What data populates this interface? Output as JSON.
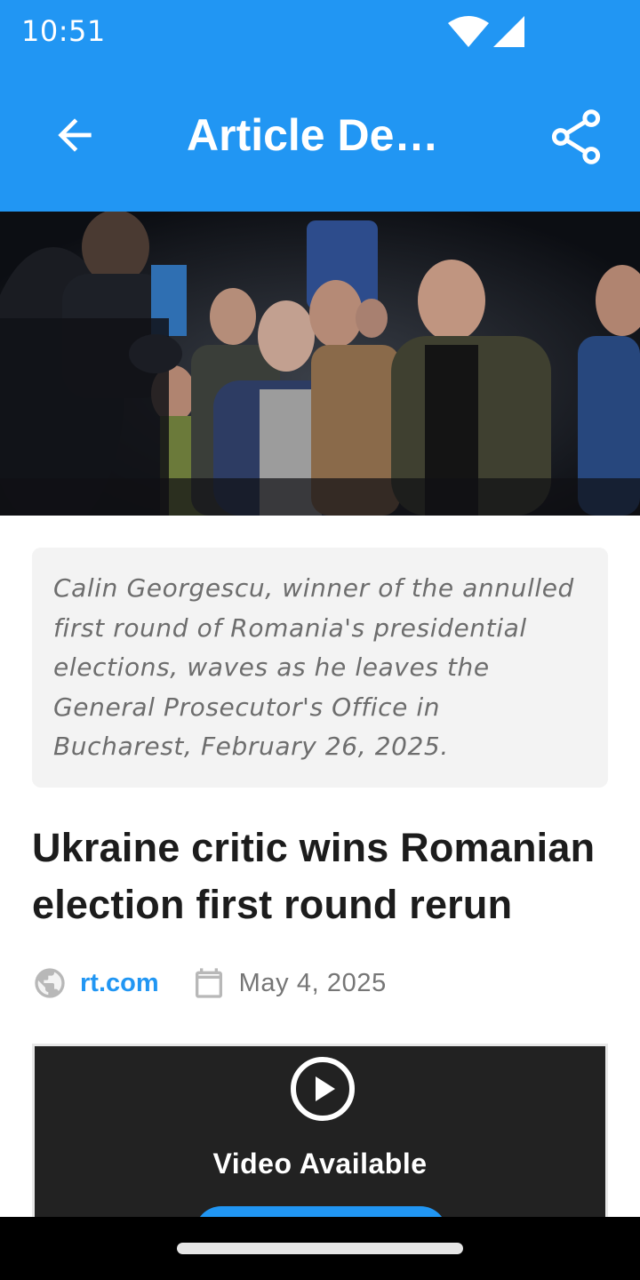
{
  "status_bar": {
    "time": "10:51",
    "icons": [
      "wifi-icon",
      "cellular-signal-icon"
    ]
  },
  "app_bar": {
    "title": "Article Det…",
    "back_icon": "arrow-left-icon",
    "share_icon": "share-icon",
    "background": "#2196f3"
  },
  "hero_image": {
    "description_icon": "photo"
  },
  "caption": {
    "text": "Calin Georgescu, winner of the annulled first round of Romania's presidential elections, waves as he leaves the General Prosecutor's Office in Bucharest, February 26, 2025."
  },
  "article": {
    "headline": "Ukraine critic wins Romanian election first round rerun",
    "source": "rt.com",
    "date": "May 4, 2025",
    "accent_color": "#2196f3"
  },
  "video": {
    "label": "Video Available",
    "icon": "play-circle-icon"
  }
}
